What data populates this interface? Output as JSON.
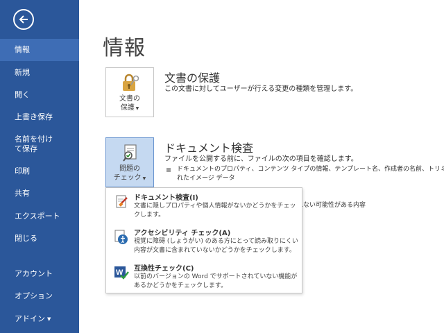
{
  "sidebar": {
    "items": [
      {
        "label": "情報"
      },
      {
        "label": "新規"
      },
      {
        "label": "開く"
      },
      {
        "label": "上書き保存"
      },
      {
        "label": "名前を付けて保存"
      },
      {
        "label": "印刷"
      },
      {
        "label": "共有"
      },
      {
        "label": "エクスポート"
      },
      {
        "label": "閉じる"
      },
      {
        "label": "アカウント"
      },
      {
        "label": "オプション"
      },
      {
        "label": "アドイン"
      }
    ]
  },
  "page_title": "情報",
  "protect": {
    "tile_label_1": "文書の",
    "tile_label_2": "保護",
    "title": "文書の保護",
    "desc": "この文書に対してユーザーが行える変更の種類を管理します。"
  },
  "inspect": {
    "tile_label_1": "問題の",
    "tile_label_2": "チェック",
    "title": "ドキュメント検査",
    "desc": "ファイルを公開する前に、ファイルの次の項目を確認します。",
    "bullet_1": "ドキュメントのプロパティ、コンテンツ タイプの情報、テンプレート名、作成者の名前、トリミングさ",
    "bullet_1_cont": "れたイメージ データ",
    "bullet_2_partial": "れない可能性がある内容"
  },
  "dropdown": {
    "items": [
      {
        "title": "ドキュメント検査(I)",
        "desc": "文書に隠しプロパティや個人情報がないかどうかをチェックします。"
      },
      {
        "title": "アクセシビリティ チェック(A)",
        "desc": "視覚に障碍 (しょうがい) のある方にとって読み取りにくい内容が文書に含まれていないかどうかをチェックします。"
      },
      {
        "title": "互換性チェック(C)",
        "desc": "以前のバージョンの Word でサポートされていない機能があるかどうかをチェックします。"
      }
    ]
  },
  "colors": {
    "sidebar": "#2b579a",
    "sidebar_active": "#3e6db5",
    "tile_pressed": "#c5d9f1"
  }
}
